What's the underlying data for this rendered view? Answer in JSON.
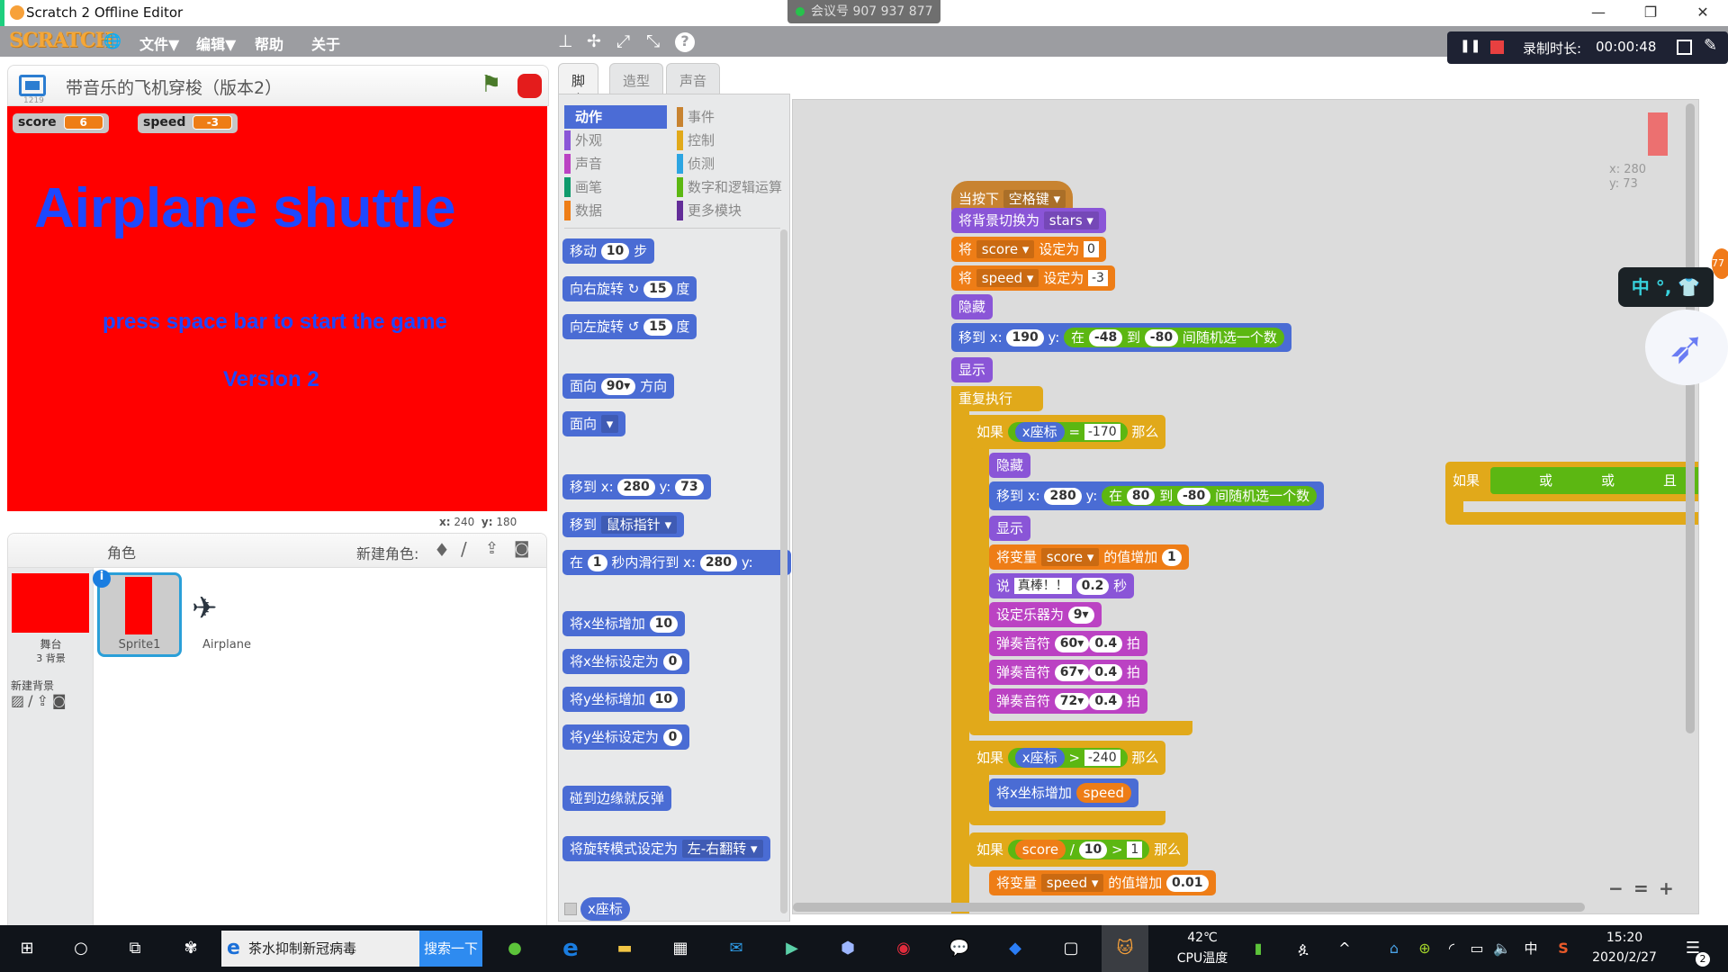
{
  "window": {
    "title": "Scratch 2 Offline Editor",
    "minimize": "—",
    "restore": "❐",
    "close": "✕"
  },
  "meeting": {
    "label": "会议号 907 937 877"
  },
  "menubar": {
    "logo": "SCRATCH",
    "globe": "🌐",
    "items": [
      "文件▼",
      "编辑▼",
      "帮助",
      "关于"
    ],
    "tools": [
      "⊥",
      "✢",
      "⤢",
      "⤡",
      "?"
    ]
  },
  "recording": {
    "pause": "❚❚",
    "label": "录制时长:",
    "time": "00:00:48"
  },
  "stage": {
    "project_title": "带音乐的飞机穿梭（版本2）",
    "version_id": "1219",
    "monitors": [
      {
        "name": "score",
        "value": "6"
      },
      {
        "name": "speed",
        "value": "-3"
      }
    ],
    "title_text": "Airplane shuttle",
    "subtitle": "press space bar to start the game",
    "version": "Version 2",
    "coords": {
      "x_label": "x:",
      "x": "240",
      "y_label": "y:",
      "y": "180"
    }
  },
  "sprites": {
    "header": "角色",
    "new_sprite_label": "新建角色:",
    "stage_label": "舞台",
    "backdrop_count": "3 背景",
    "new_backdrop": "新建背景",
    "items": [
      {
        "name": "Sprite1"
      },
      {
        "name": "Airplane"
      }
    ]
  },
  "tabs": [
    "脚本",
    "造型",
    "声音"
  ],
  "categories": [
    {
      "label": "动作",
      "color": "#4a6cd4"
    },
    {
      "label": "外观",
      "color": "#8a55d7"
    },
    {
      "label": "声音",
      "color": "#bb42c3"
    },
    {
      "label": "画笔",
      "color": "#0e9a6c"
    },
    {
      "label": "数据",
      "color": "#ee7d16"
    },
    {
      "label": "事件",
      "color": "#c88330"
    },
    {
      "label": "控制",
      "color": "#e1a91a"
    },
    {
      "label": "侦测",
      "color": "#2ca5e2"
    },
    {
      "label": "数字和逻辑运算",
      "color": "#5cb712"
    },
    {
      "label": "更多模块",
      "color": "#632d99"
    }
  ],
  "palette": {
    "move": [
      "移动",
      "10",
      "步"
    ],
    "turn_right": [
      "向右旋转",
      "↻",
      "15",
      "度"
    ],
    "turn_left": [
      "向左旋转",
      "↺",
      "15",
      "度"
    ],
    "point_dir": [
      "面向",
      "90▾",
      "方向"
    ],
    "point_towards": [
      "面向",
      "▾"
    ],
    "goto_xy": [
      "移到 x:",
      "280",
      "y:",
      "73"
    ],
    "goto": [
      "移到",
      "鼠标指针 ▾"
    ],
    "glide": [
      "在",
      "1",
      "秒内滑行到 x:",
      "280",
      "y:"
    ],
    "change_x": [
      "将x坐标增加",
      "10"
    ],
    "set_x": [
      "将x坐标设定为",
      "0"
    ],
    "change_y": [
      "将y坐标增加",
      "10"
    ],
    "set_y": [
      "将y坐标设定为",
      "0"
    ],
    "bounce": "碰到边缘就反弹",
    "rotation_style": [
      "将旋转模式设定为",
      "左-右翻转 ▾"
    ],
    "x_reporter": "x座标"
  },
  "script": {
    "hat": [
      "当按下",
      "空格键 ▾"
    ],
    "switch_bg": [
      "将背景切换为",
      "stars ▾"
    ],
    "set_score": [
      "将",
      "score ▾",
      "设定为",
      "0"
    ],
    "set_speed": [
      "将",
      "speed ▾",
      "设定为",
      "-3"
    ],
    "hide": "隐藏",
    "goto1": [
      "移到 x:",
      "190",
      "y:",
      "在",
      "-48",
      "到",
      "-80",
      "间随机选一个数"
    ],
    "show": "显示",
    "forever": "重复执行",
    "if1": [
      "如果",
      "x座标",
      "=",
      "-170",
      "那么"
    ],
    "hide2": "隐藏",
    "goto2": [
      "移到 x:",
      "280",
      "y:",
      "在",
      "80",
      "到",
      "-80",
      "间随机选一个数"
    ],
    "show2": "显示",
    "change_score": [
      "将变量",
      "score ▾",
      "的值增加",
      "1"
    ],
    "say": [
      "说",
      "真棒！！",
      "0.2",
      "秒"
    ],
    "instrument": [
      "设定乐器为",
      "9▾"
    ],
    "notes": [
      [
        "弹奏音符",
        "60▾",
        "0.4",
        "拍"
      ],
      [
        "弹奏音符",
        "67▾",
        "0.4",
        "拍"
      ],
      [
        "弹奏音符",
        "72▾",
        "0.4",
        "拍"
      ]
    ],
    "if2": [
      "如果",
      "x座标",
      ">",
      "-240",
      "那么"
    ],
    "change_x": [
      "将x坐标增加",
      "speed"
    ],
    "if3": [
      "如果",
      "score",
      "/",
      "10",
      ">",
      "1",
      "那么"
    ],
    "change_speed": [
      "将变量",
      "speed ▾",
      "的值增加",
      "0.01"
    ],
    "loose_if": [
      "如果",
      "或",
      "或",
      "且"
    ],
    "sprite_xy": {
      "x": "x: 280",
      "y": "y: 73"
    }
  },
  "zoom_controls": [
    "−",
    "=",
    "+"
  ],
  "ime": {
    "label": "中 °, 👕",
    "badge": "77"
  },
  "taskbar": {
    "search_text": "茶水抑制新冠病毒",
    "search_button": "搜索一下",
    "cpu_temp": "42℃",
    "cpu_label": "CPU温度",
    "ime": "中",
    "time": "15:20",
    "date": "2020/2/27",
    "notifications": "2"
  }
}
